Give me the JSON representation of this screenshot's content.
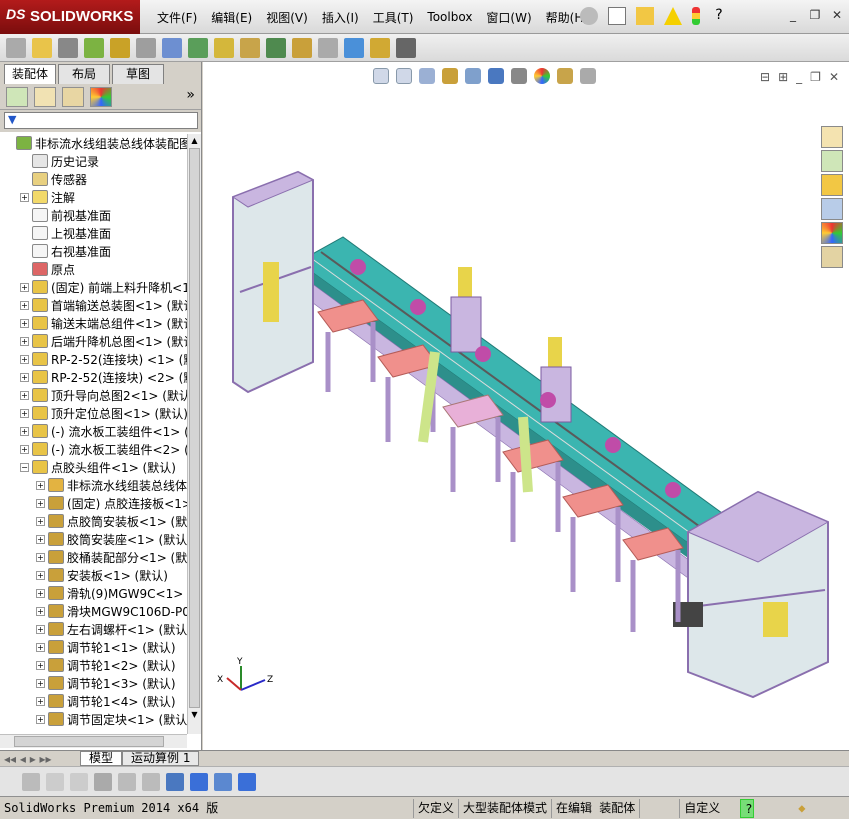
{
  "app": {
    "logo_ds": "DS",
    "logo_text": "SOLIDWORKS"
  },
  "menu": [
    "文件(F)",
    "编辑(E)",
    "视图(V)",
    "插入(I)",
    "工具(T)",
    "Toolbox",
    "窗口(W)",
    "帮助(H)"
  ],
  "panel_tabs": [
    "装配体",
    "布局",
    "草图"
  ],
  "panel_more": "»",
  "filter_icon": "▼",
  "tree": [
    {
      "label": "非标流水线组装总线体装配图",
      "icon": "assembly-icon",
      "depth": 0,
      "exp": ""
    },
    {
      "label": "历史记录",
      "icon": "history-icon",
      "depth": 1,
      "exp": ""
    },
    {
      "label": "传感器",
      "icon": "sensor-icon",
      "depth": 1,
      "exp": ""
    },
    {
      "label": "注解",
      "icon": "annotation-icon",
      "depth": 1,
      "exp": "+"
    },
    {
      "label": "前视基准面",
      "icon": "plane-icon",
      "depth": 1,
      "exp": ""
    },
    {
      "label": "上视基准面",
      "icon": "plane-icon",
      "depth": 1,
      "exp": ""
    },
    {
      "label": "右视基准面",
      "icon": "plane-icon",
      "depth": 1,
      "exp": ""
    },
    {
      "label": "原点",
      "icon": "origin-icon",
      "depth": 1,
      "exp": ""
    },
    {
      "label": "(固定) 前端上料升降机<1>",
      "icon": "subassembly-icon",
      "depth": 1,
      "exp": "+"
    },
    {
      "label": "首端输送总装图<1> (默认)",
      "icon": "subassembly-icon",
      "depth": 1,
      "exp": "+"
    },
    {
      "label": "输送末端总组件<1> (默认)",
      "icon": "subassembly-icon",
      "depth": 1,
      "exp": "+"
    },
    {
      "label": "后端升降机总图<1> (默认)",
      "icon": "subassembly-icon",
      "depth": 1,
      "exp": "+"
    },
    {
      "label": "RP-2-52(连接块) <1> (默认)",
      "icon": "subassembly-icon",
      "depth": 1,
      "exp": "+"
    },
    {
      "label": "RP-2-52(连接块) <2> (默认)",
      "icon": "subassembly-icon",
      "depth": 1,
      "exp": "+"
    },
    {
      "label": "顶升导向总图2<1> (默认)",
      "icon": "subassembly-icon",
      "depth": 1,
      "exp": "+"
    },
    {
      "label": "顶升定位总图<1> (默认)",
      "icon": "subassembly-icon",
      "depth": 1,
      "exp": "+"
    },
    {
      "label": "(-) 流水板工装组件<1> (默",
      "icon": "subassembly-icon",
      "depth": 1,
      "exp": "+"
    },
    {
      "label": "(-) 流水板工装组件<2> (默",
      "icon": "subassembly-icon",
      "depth": 1,
      "exp": "+"
    },
    {
      "label": "点胶头组件<1> (默认)",
      "icon": "subassembly-icon",
      "depth": 1,
      "exp": "−"
    },
    {
      "label": "非标流水线组装总线体装",
      "icon": "mate-icon",
      "depth": 2,
      "exp": "+"
    },
    {
      "label": "(固定) 点胶连接板<1>",
      "icon": "part-icon",
      "depth": 2,
      "exp": "+"
    },
    {
      "label": "点胶筒安装板<1> (默认)",
      "icon": "part-icon",
      "depth": 2,
      "exp": "+"
    },
    {
      "label": "胶筒安装座<1> (默认)",
      "icon": "part-icon",
      "depth": 2,
      "exp": "+"
    },
    {
      "label": "胶桶装配部分<1> (默认)",
      "icon": "part-icon",
      "depth": 2,
      "exp": "+"
    },
    {
      "label": "安装板<1> (默认)",
      "icon": "part-icon",
      "depth": 2,
      "exp": "+"
    },
    {
      "label": "滑轨(9)MGW9C<1> (默认)",
      "icon": "part-icon",
      "depth": 2,
      "exp": "+"
    },
    {
      "label": "滑块MGW9C106D-P02-60",
      "icon": "part-icon",
      "depth": 2,
      "exp": "+"
    },
    {
      "label": "左右调螺杆<1> (默认)",
      "icon": "part-icon",
      "depth": 2,
      "exp": "+"
    },
    {
      "label": "调节轮1<1> (默认)",
      "icon": "part-icon",
      "depth": 2,
      "exp": "+"
    },
    {
      "label": "调节轮1<2> (默认)",
      "icon": "part-icon",
      "depth": 2,
      "exp": "+"
    },
    {
      "label": "调节轮1<3> (默认)",
      "icon": "part-icon",
      "depth": 2,
      "exp": "+"
    },
    {
      "label": "调节轮1<4> (默认)",
      "icon": "part-icon",
      "depth": 2,
      "exp": "+"
    },
    {
      "label": "调节固定块<1> (默认)",
      "icon": "part-icon",
      "depth": 2,
      "exp": "+"
    }
  ],
  "bottom_tabs": [
    "模型",
    "运动算例 1"
  ],
  "axes": {
    "x": "X",
    "y": "Y",
    "z": "Z"
  },
  "status": {
    "version": "SolidWorks Premium 2014 x64 版",
    "underdefined": "欠定义",
    "large_asm": "大型装配体模式",
    "editing": "在编辑 装配体",
    "custom": "自定义",
    "help": "?"
  },
  "colors": {
    "accent": "#7a0d0d",
    "frame": "#c9b6e0",
    "conveyor": "#3bb5b0",
    "pad": "#f0908c",
    "yellow": "#e8d44a"
  }
}
